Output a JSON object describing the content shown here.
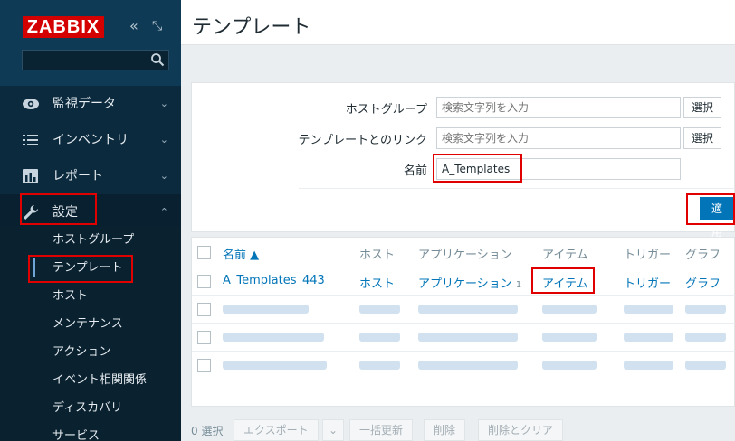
{
  "app": {
    "logo": "ZABBIX",
    "collapse_icon": "«",
    "kiosk_icon": "⤡"
  },
  "sidebar": {
    "menu": [
      {
        "label": "監視データ",
        "icon": "eye-icon",
        "chevron": "⌄"
      },
      {
        "label": "インベントリ",
        "icon": "list-icon",
        "chevron": "⌄"
      },
      {
        "label": "レポート",
        "icon": "bar-chart-icon",
        "chevron": "⌄"
      },
      {
        "label": "設定",
        "icon": "wrench-icon",
        "chevron": "⌃"
      }
    ],
    "submenu": [
      {
        "label": "ホストグループ"
      },
      {
        "label": "テンプレート"
      },
      {
        "label": "ホスト"
      },
      {
        "label": "メンテナンス"
      },
      {
        "label": "アクション"
      },
      {
        "label": "イベント相関関係"
      },
      {
        "label": "ディスカバリ"
      },
      {
        "label": "サービス"
      }
    ]
  },
  "header": {
    "title": "テンプレート"
  },
  "filter": {
    "host_group_label": "ホストグループ",
    "host_group_placeholder": "検索文字列を入力",
    "link_label": "テンプレートとのリンク",
    "link_placeholder": "検索文字列を入力",
    "name_label": "名前",
    "name_value": "A_Templates",
    "select_button": "選択",
    "apply_button": "適用"
  },
  "table": {
    "headers": {
      "name": "名前 ▲",
      "hosts": "ホスト",
      "applications": "アプリケーション",
      "items": "アイテム",
      "triggers": "トリガー",
      "graphs": "グラフ"
    },
    "row": {
      "name": "A_Templates_443",
      "hosts": "ホスト",
      "applications": "アプリケーション",
      "app_count": "1",
      "items": "アイテム",
      "triggers": "トリガー",
      "graphs": "グラフ"
    }
  },
  "footer": {
    "selected": "0 選択",
    "export": "エクスポート",
    "export_arrow": "⌄",
    "mass_update": "一括更新",
    "delete": "削除",
    "delete_clear": "削除とクリア"
  }
}
